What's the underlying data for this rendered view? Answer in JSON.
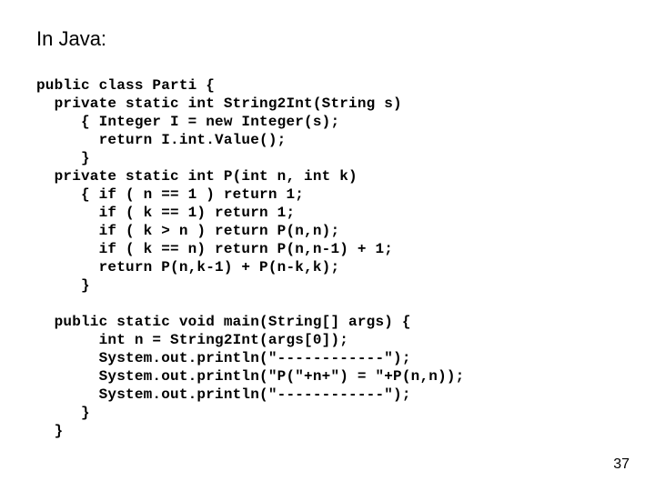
{
  "heading": "In Java:",
  "code_lines": [
    "public class Parti {",
    "  private static int String2Int(String s)",
    "     { Integer I = new Integer(s);",
    "       return I.int.Value();",
    "     }",
    "  private static int P(int n, int k)",
    "     { if ( n == 1 ) return 1;",
    "       if ( k == 1) return 1;",
    "       if ( k > n ) return P(n,n);",
    "       if ( k == n) return P(n,n-1) + 1;",
    "       return P(n,k-1) + P(n-k,k);",
    "     }",
    "",
    "  public static void main(String[] args) {",
    "       int n = String2Int(args[0]);",
    "       System.out.println(\"------------\");",
    "       System.out.println(\"P(\"+n+\") = \"+P(n,n));",
    "       System.out.println(\"------------\");",
    "     }",
    "  }"
  ],
  "page_number": "37"
}
